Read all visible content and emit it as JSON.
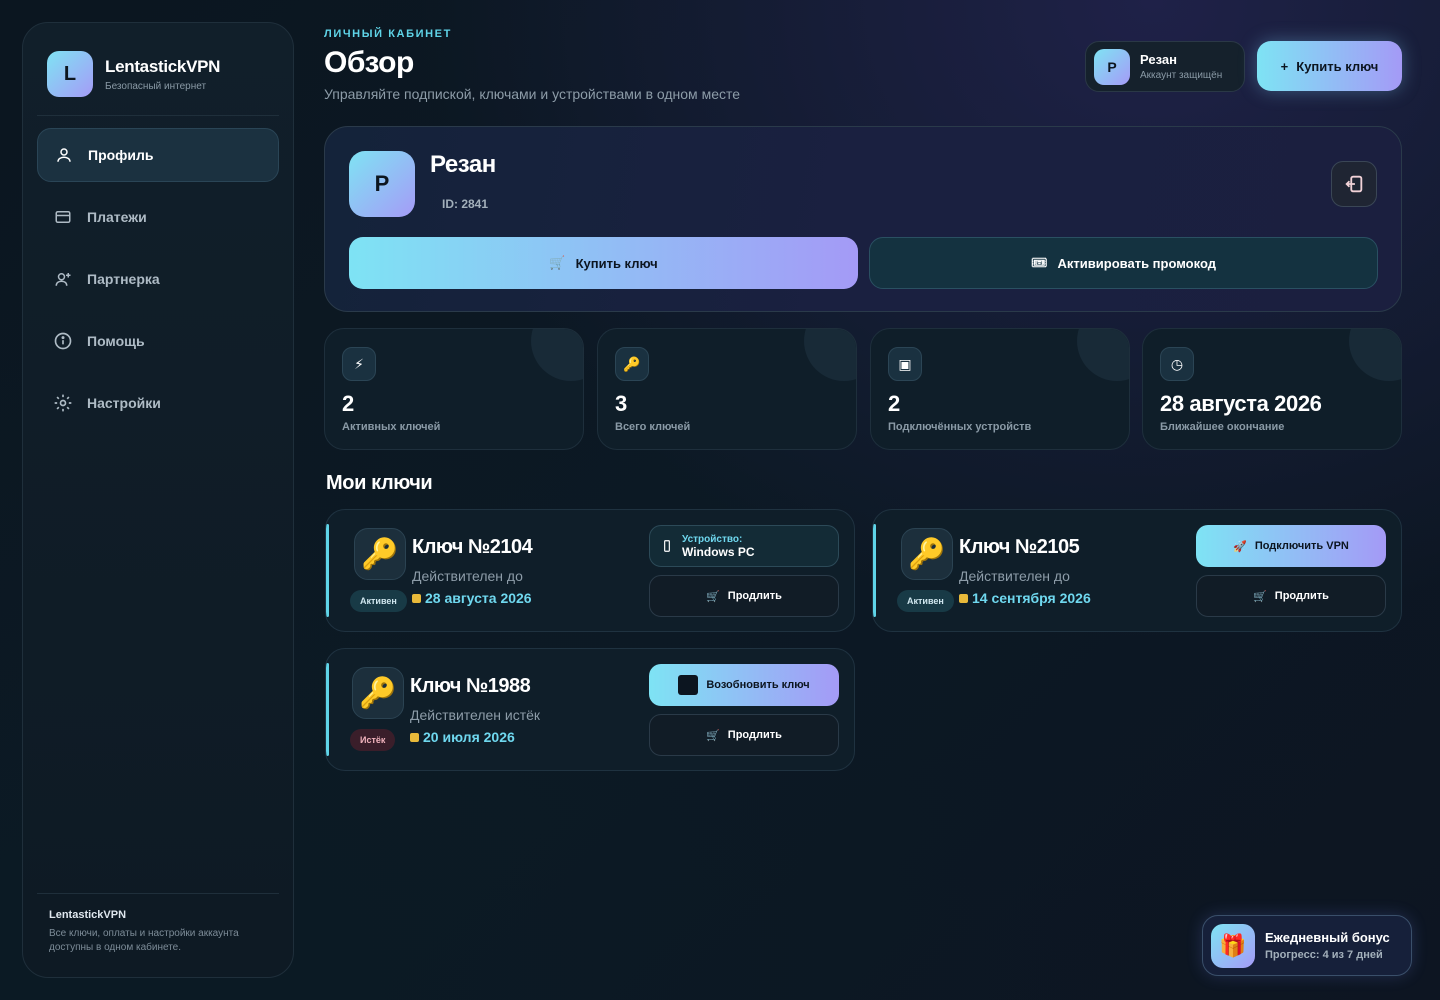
{
  "brand": {
    "logo_letter": "L",
    "name": "LentastickVPN",
    "tagline": "Безопасный интернет"
  },
  "sidebar": {
    "items": [
      {
        "label": "Профиль",
        "icon": "user-icon",
        "active": true
      },
      {
        "label": "Платежи",
        "icon": "card-icon",
        "active": false
      },
      {
        "label": "Партнерка",
        "icon": "users-plus-icon",
        "active": false
      },
      {
        "label": "Помощь",
        "icon": "info-icon",
        "active": false
      },
      {
        "label": "Настройки",
        "icon": "gear-icon",
        "active": false
      }
    ],
    "footer": {
      "title": "LentastickVPN",
      "text": "Все ключи, оплаты и настройки аккаунта доступны в одном кабинете."
    }
  },
  "header": {
    "eyebrow": "ЛИЧНЫЙ КАБИНЕТ",
    "title": "Обзор",
    "subtitle": "Управляйте подпиской, ключами и устройствами в одном месте",
    "user": {
      "avatar_letter": "Р",
      "name": "Резан",
      "status": "Аккаунт защищён"
    },
    "buy_button": "Купить ключ",
    "buy_icon": "+"
  },
  "profile": {
    "avatar_letter": "Р",
    "name": "Резан",
    "id_label": "ID: 2841",
    "buy_label": "Купить ключ",
    "buy_icon": "🛒",
    "promo_label": "Активировать промокод",
    "promo_icon": "🎟"
  },
  "stats": [
    {
      "icon": "⚡",
      "icon_name": "lightning-icon",
      "value": "2",
      "label": "Активных ключей"
    },
    {
      "icon": "🔑",
      "icon_name": "key-icon",
      "value": "3",
      "label": "Всего ключей"
    },
    {
      "icon": "▣",
      "icon_name": "device-icon",
      "value": "2",
      "label": "Подключённых устройств"
    },
    {
      "icon": "◷",
      "icon_name": "clock-icon",
      "value": "28 августа 2026",
      "label": "Ближайшее окончание"
    }
  ],
  "keys_section": {
    "title": "Мои ключи"
  },
  "keys": [
    {
      "name": "Ключ №2104",
      "valid_text": "Действителен до",
      "date": "28 августа 2026",
      "status": "Активен",
      "device_label": "Устройство:",
      "device_value": "Windows PC",
      "extend_label": "Продлить"
    },
    {
      "name": "Ключ №2105",
      "valid_text": "Действителен до",
      "date": "14 сентября 2026",
      "status": "Активен",
      "connect_label": "Подключить VPN",
      "extend_label": "Продлить"
    },
    {
      "name": "Ключ №1988",
      "valid_text": "Действителен истёк",
      "date": "20 июля 2026",
      "status": "Истёк",
      "renew_label": "Возобновить ключ",
      "extend_label": "Продлить"
    }
  ],
  "bonus": {
    "icon": "🎁",
    "title": "Ежедневный бонус",
    "progress": "Прогресс: 4 из 7 дней"
  },
  "colors": {
    "accent_cyan": "#7ee3f4",
    "accent_violet": "#a49af6",
    "expired": "#f1b3bd",
    "date_text": "#6fd8ef"
  }
}
